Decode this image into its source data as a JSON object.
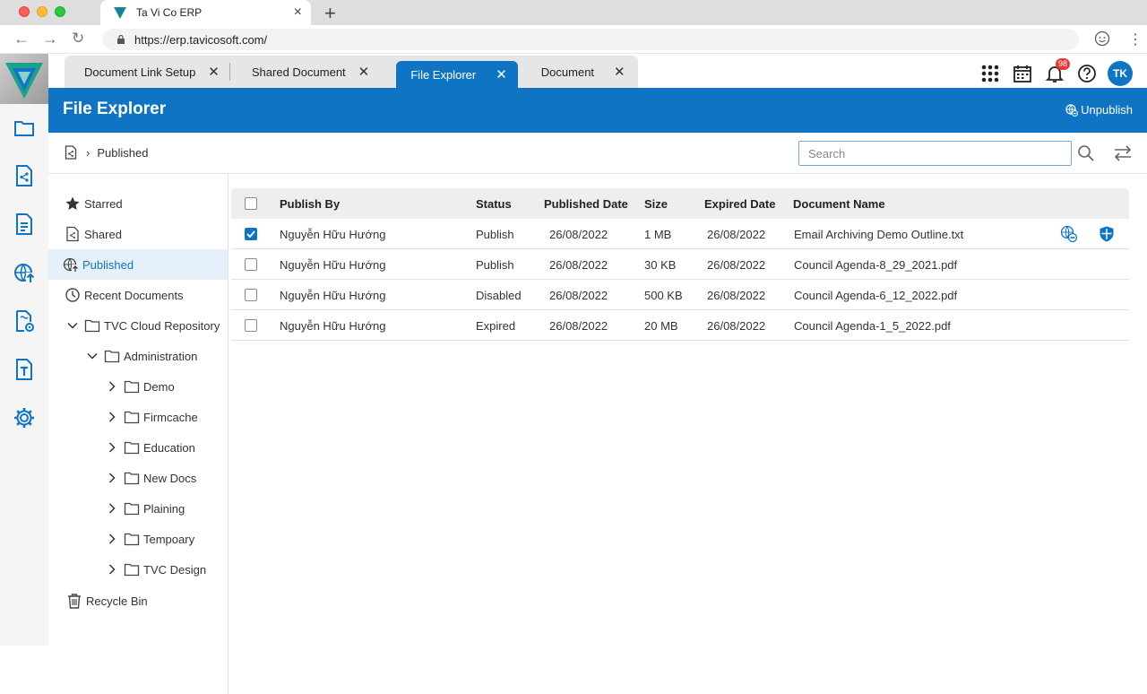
{
  "browser": {
    "tab_title": "Ta Vi Co ERP",
    "url": "https://erp.tavicosoft.com/"
  },
  "app_tabs": [
    {
      "label": "Document Link Setup",
      "active": false
    },
    {
      "label": "Shared Document",
      "active": false
    },
    {
      "label": "File Explorer",
      "active": true
    },
    {
      "label": "Document",
      "active": false
    }
  ],
  "header": {
    "notification_count": "98",
    "avatar_initials": "TK",
    "title": "File Explorer",
    "unpublish_label": "Unpublish"
  },
  "breadcrumb": {
    "current": "Published"
  },
  "search": {
    "placeholder": "Search",
    "value": ""
  },
  "tree": {
    "starred": "Starred",
    "shared": "Shared",
    "published": "Published",
    "recent": "Recent Documents",
    "repository": "TVC Cloud Repository",
    "administration": "Administration",
    "folders": [
      "Demo",
      "Firmcache",
      "Education",
      "New Docs",
      "Plaining",
      "Tempoary",
      "TVC Design"
    ],
    "recycle": "Recycle Bin"
  },
  "table": {
    "columns": {
      "publish_by": "Publish By",
      "status": "Status",
      "published_date": "Published Date",
      "size": "Size",
      "expired_date": "Expired Date",
      "document_name": "Document Name"
    },
    "rows": [
      {
        "checked": true,
        "publish_by": "Nguyễn Hữu Hướng",
        "status": "Publish",
        "published_date": "26/08/2022",
        "size": "1 MB",
        "expired_date": "26/08/2022",
        "document_name": "Email Archiving Demo Outline.txt"
      },
      {
        "checked": false,
        "publish_by": "Nguyễn Hữu Hướng",
        "status": "Publish",
        "published_date": "26/08/2022",
        "size": "30 KB",
        "expired_date": "26/08/2022",
        "document_name": "Council Agenda-8_29_2021.pdf"
      },
      {
        "checked": false,
        "publish_by": "Nguyễn Hữu Hướng",
        "status": "Disabled",
        "published_date": "26/08/2022",
        "size": "500 KB",
        "expired_date": "26/08/2022",
        "document_name": "Council Agenda-6_12_2022.pdf"
      },
      {
        "checked": false,
        "publish_by": "Nguyễn Hữu Hướng",
        "status": "Expired",
        "published_date": "26/08/2022",
        "size": "20 MB",
        "expired_date": "26/08/2022",
        "document_name": "Council Agenda-1_5_2022.pdf"
      }
    ]
  },
  "colors": {
    "brand": "#0f74c4",
    "selected_bg": "#e6f0fa"
  }
}
